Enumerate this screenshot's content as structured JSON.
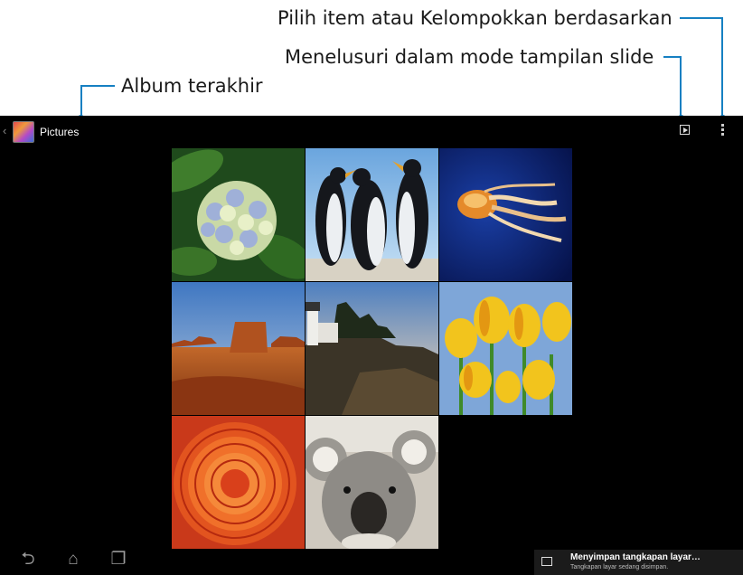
{
  "callouts": {
    "select_group": "Pilih item atau Kelompokkan berdasarkan",
    "slideshow": "Menelusuri dalam mode tampilan slide",
    "recent_album": "Album terakhir"
  },
  "colors": {
    "callout_line": "#1680c2",
    "screen_bg": "#000000"
  },
  "action_bar": {
    "back_icon": "chevron-left-icon",
    "album_icon": "pictures-album-icon",
    "title": "Pictures",
    "slideshow_icon": "play-square-icon",
    "overflow_icon": "more-vertical-icon"
  },
  "gallery": {
    "photos": [
      "hydrangea",
      "penguins",
      "jellyfish",
      "desert",
      "lighthouse",
      "tulips",
      "chrysanthemum",
      "koala"
    ]
  },
  "nav_bar": {
    "back_icon": "back-icon",
    "home_icon": "home-icon",
    "recents_icon": "recent-apps-icon"
  },
  "toast": {
    "icon": "image-icon",
    "title": "Menyimpan tangkapan layar…",
    "subtitle": "Tangkapan layar sedang disimpan."
  }
}
